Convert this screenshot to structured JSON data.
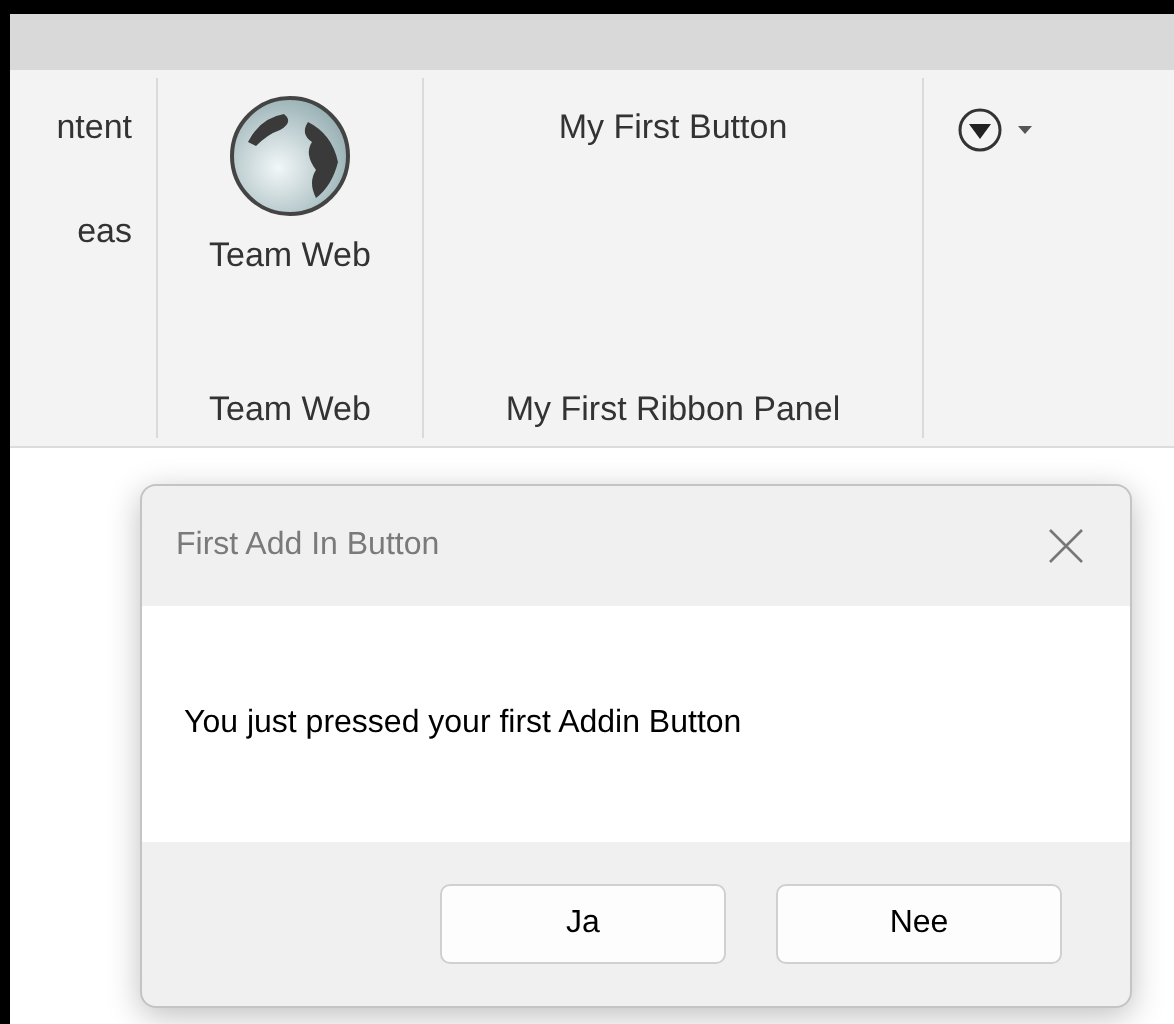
{
  "ribbon": {
    "partial_items": [
      "ntent",
      "eas"
    ],
    "groups": [
      {
        "label": "Team Web",
        "button": {
          "label": "Team Web"
        }
      },
      {
        "label": "My First Ribbon Panel",
        "button": {
          "label": "My First Button"
        }
      }
    ]
  },
  "dialog": {
    "title": "First Add In Button",
    "message": "You just pressed your first Addin Button",
    "buttons": [
      "Ja",
      "Nee"
    ]
  }
}
